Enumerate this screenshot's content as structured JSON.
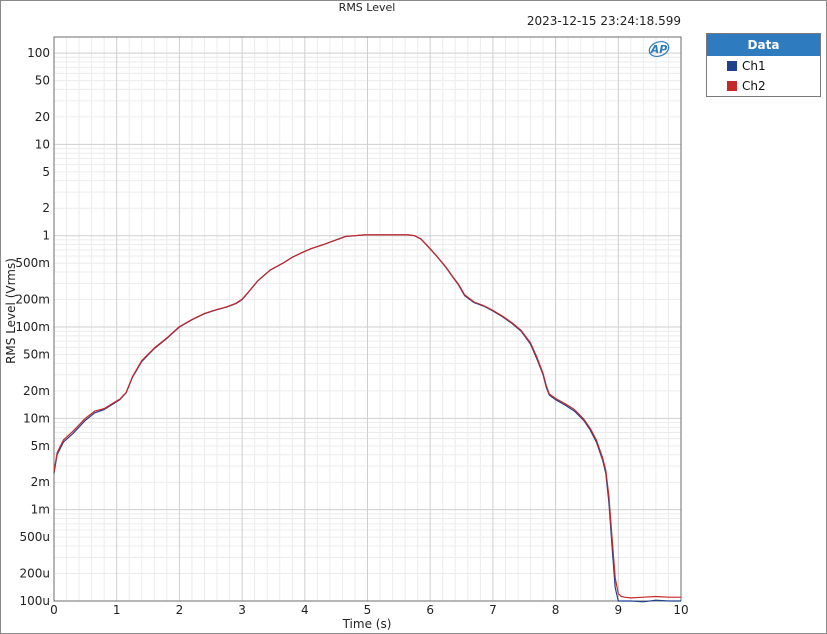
{
  "chart_data": {
    "type": "line",
    "title": "RMS Level",
    "timestamp": "2023-12-15 23:24:18.599",
    "xlabel": "Time (s)",
    "ylabel": "RMS Level (Vrms)",
    "xlim": [
      0,
      10
    ],
    "ylim": [
      0.0001,
      150
    ],
    "yscale": "log",
    "grid": true,
    "legend_position": "right",
    "x_ticks": [
      {
        "value": 0,
        "label": "0"
      },
      {
        "value": 1,
        "label": "1"
      },
      {
        "value": 2,
        "label": "2"
      },
      {
        "value": 3,
        "label": "3"
      },
      {
        "value": 4,
        "label": "4"
      },
      {
        "value": 5,
        "label": "5"
      },
      {
        "value": 6,
        "label": "6"
      },
      {
        "value": 7,
        "label": "7"
      },
      {
        "value": 8,
        "label": "8"
      },
      {
        "value": 9,
        "label": "9"
      },
      {
        "value": 10,
        "label": "10"
      }
    ],
    "y_ticks": [
      {
        "value": 100,
        "label": "100"
      },
      {
        "value": 50,
        "label": "50"
      },
      {
        "value": 20,
        "label": "20"
      },
      {
        "value": 10,
        "label": "10"
      },
      {
        "value": 5,
        "label": "5"
      },
      {
        "value": 2,
        "label": "2"
      },
      {
        "value": 1,
        "label": "1"
      },
      {
        "value": 0.5,
        "label": "500m"
      },
      {
        "value": 0.2,
        "label": "200m"
      },
      {
        "value": 0.1,
        "label": "100m"
      },
      {
        "value": 0.05,
        "label": "50m"
      },
      {
        "value": 0.02,
        "label": "20m"
      },
      {
        "value": 0.01,
        "label": "10m"
      },
      {
        "value": 0.005,
        "label": "5m"
      },
      {
        "value": 0.002,
        "label": "2m"
      },
      {
        "value": 0.001,
        "label": "1m"
      },
      {
        "value": 0.0005,
        "label": "500u"
      },
      {
        "value": 0.0002,
        "label": "200u"
      },
      {
        "value": 0.0001,
        "label": "100u"
      }
    ],
    "series": [
      {
        "name": "Ch1",
        "color": "#1f3f8f",
        "x": [
          0,
          0.05,
          0.15,
          0.3,
          0.5,
          0.65,
          0.8,
          0.95,
          1.05,
          1.15,
          1.25,
          1.4,
          1.6,
          1.8,
          2.0,
          2.2,
          2.4,
          2.6,
          2.75,
          2.9,
          3.0,
          3.1,
          3.25,
          3.45,
          3.65,
          3.8,
          3.95,
          4.1,
          4.3,
          4.5,
          4.65,
          4.8,
          4.95,
          5.1,
          5.3,
          5.5,
          5.65,
          5.75,
          5.85,
          5.95,
          6.1,
          6.25,
          6.35,
          6.45,
          6.55,
          6.7,
          6.85,
          7.0,
          7.15,
          7.3,
          7.45,
          7.6,
          7.7,
          7.8,
          7.85,
          7.9,
          8.0,
          8.15,
          8.3,
          8.45,
          8.55,
          8.65,
          8.75,
          8.8,
          8.85,
          8.9,
          8.95,
          9.0,
          9.05,
          9.1,
          9.2,
          9.4,
          9.6,
          9.8,
          10.0
        ],
        "y": [
          0.0025,
          0.004,
          0.0055,
          0.0068,
          0.0095,
          0.0115,
          0.0125,
          0.0145,
          0.016,
          0.019,
          0.028,
          0.042,
          0.058,
          0.075,
          0.1,
          0.12,
          0.14,
          0.155,
          0.165,
          0.18,
          0.2,
          0.24,
          0.32,
          0.42,
          0.5,
          0.58,
          0.65,
          0.72,
          0.8,
          0.9,
          0.98,
          1.0,
          1.02,
          1.02,
          1.02,
          1.02,
          1.02,
          1.0,
          0.92,
          0.78,
          0.6,
          0.45,
          0.36,
          0.29,
          0.22,
          0.185,
          0.17,
          0.15,
          0.13,
          0.11,
          0.09,
          0.065,
          0.045,
          0.03,
          0.022,
          0.018,
          0.016,
          0.014,
          0.012,
          0.0095,
          0.0075,
          0.0055,
          0.0035,
          0.0025,
          0.0012,
          0.0004,
          0.00014,
          0.0001,
          0.0001,
          0.0001,
          0.0001,
          9.8e-05,
          0.000102,
          0.0001,
          0.0001
        ]
      },
      {
        "name": "Ch2",
        "color": "#c62828",
        "x": [
          0,
          0.05,
          0.15,
          0.3,
          0.5,
          0.65,
          0.8,
          0.95,
          1.05,
          1.15,
          1.25,
          1.4,
          1.6,
          1.8,
          2.0,
          2.2,
          2.4,
          2.6,
          2.75,
          2.9,
          3.0,
          3.1,
          3.25,
          3.45,
          3.65,
          3.8,
          3.95,
          4.1,
          4.3,
          4.5,
          4.65,
          4.8,
          4.95,
          5.1,
          5.3,
          5.5,
          5.65,
          5.75,
          5.85,
          5.95,
          6.1,
          6.25,
          6.35,
          6.45,
          6.55,
          6.7,
          6.85,
          7.0,
          7.15,
          7.3,
          7.45,
          7.6,
          7.7,
          7.8,
          7.85,
          7.9,
          8.0,
          8.15,
          8.3,
          8.45,
          8.55,
          8.65,
          8.75,
          8.8,
          8.85,
          8.9,
          8.95,
          9.0,
          9.05,
          9.1,
          9.2,
          9.4,
          9.6,
          9.8,
          10.0
        ],
        "y": [
          0.0026,
          0.0042,
          0.0058,
          0.0072,
          0.01,
          0.012,
          0.0128,
          0.0148,
          0.0162,
          0.0192,
          0.0285,
          0.043,
          0.059,
          0.076,
          0.101,
          0.121,
          0.141,
          0.156,
          0.166,
          0.182,
          0.202,
          0.242,
          0.322,
          0.422,
          0.502,
          0.582,
          0.652,
          0.722,
          0.802,
          0.902,
          0.982,
          1.0,
          1.02,
          1.02,
          1.02,
          1.02,
          1.02,
          1.0,
          0.925,
          0.785,
          0.605,
          0.455,
          0.365,
          0.295,
          0.225,
          0.188,
          0.172,
          0.152,
          0.132,
          0.112,
          0.092,
          0.067,
          0.047,
          0.031,
          0.023,
          0.0185,
          0.0165,
          0.0145,
          0.0125,
          0.0098,
          0.0078,
          0.0058,
          0.0037,
          0.0027,
          0.0014,
          0.0005,
          0.00018,
          0.00012,
          0.000112,
          0.00011,
          0.000108,
          0.00011,
          0.000112,
          0.00011,
          0.00011
        ]
      }
    ]
  },
  "legend": {
    "header": "Data",
    "items": [
      {
        "label": "Ch1",
        "color": "#1f3f8f"
      },
      {
        "label": "Ch2",
        "color": "#c62828"
      }
    ]
  },
  "logo": {
    "text": "AP"
  }
}
